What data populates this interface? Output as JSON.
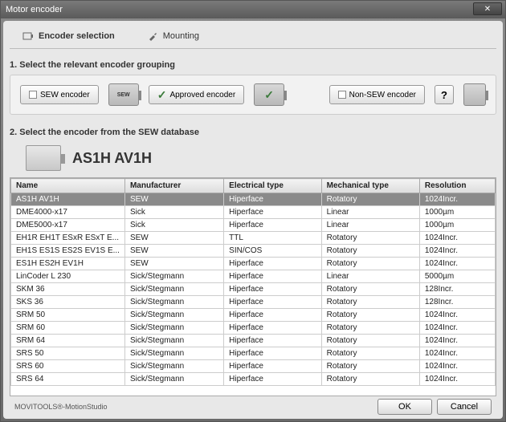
{
  "window": {
    "title": "Motor encoder"
  },
  "tabs": {
    "encoder_selection": "Encoder selection",
    "mounting": "Mounting"
  },
  "section1": {
    "heading": "1. Select the relevant encoder grouping",
    "sew_btn": "SEW encoder",
    "sew_chip": "SEW",
    "approved_btn": "Approved encoder",
    "non_sew_btn": "Non-SEW encoder",
    "help": "?"
  },
  "section2": {
    "heading": "2. Select the encoder from the SEW database",
    "selected_name": "AS1H AV1H"
  },
  "table": {
    "columns": [
      "Name",
      "Manufacturer",
      "Electrical type",
      "Mechanical type",
      "Resolution"
    ],
    "rows": [
      {
        "name": "AS1H AV1H",
        "manufacturer": "SEW",
        "electrical": "Hiperface",
        "mechanical": "Rotatory",
        "resolution": "1024Incr.",
        "selected": true
      },
      {
        "name": "DME4000-x17",
        "manufacturer": "Sick",
        "electrical": "Hiperface",
        "mechanical": "Linear",
        "resolution": "1000µm"
      },
      {
        "name": "DME5000-x17",
        "manufacturer": "Sick",
        "electrical": "Hiperface",
        "mechanical": "Linear",
        "resolution": "1000µm"
      },
      {
        "name": "EH1R EH1T ESxR ESxT E...",
        "manufacturer": "SEW",
        "electrical": "TTL",
        "mechanical": "Rotatory",
        "resolution": "1024Incr."
      },
      {
        "name": "EH1S ES1S ES2S EV1S E...",
        "manufacturer": "SEW",
        "electrical": "SIN/COS",
        "mechanical": "Rotatory",
        "resolution": "1024Incr."
      },
      {
        "name": "ES1H ES2H EV1H",
        "manufacturer": "SEW",
        "electrical": "Hiperface",
        "mechanical": "Rotatory",
        "resolution": "1024Incr."
      },
      {
        "name": "LinCoder L 230",
        "manufacturer": "Sick/Stegmann",
        "electrical": "Hiperface",
        "mechanical": "Linear",
        "resolution": "5000µm"
      },
      {
        "name": "SKM 36",
        "manufacturer": "Sick/Stegmann",
        "electrical": "Hiperface",
        "mechanical": "Rotatory",
        "resolution": "128Incr."
      },
      {
        "name": "SKS 36",
        "manufacturer": "Sick/Stegmann",
        "electrical": "Hiperface",
        "mechanical": "Rotatory",
        "resolution": "128Incr."
      },
      {
        "name": "SRM 50",
        "manufacturer": "Sick/Stegmann",
        "electrical": "Hiperface",
        "mechanical": "Rotatory",
        "resolution": "1024Incr."
      },
      {
        "name": "SRM 60",
        "manufacturer": "Sick/Stegmann",
        "electrical": "Hiperface",
        "mechanical": "Rotatory",
        "resolution": "1024Incr."
      },
      {
        "name": "SRM 64",
        "manufacturer": "Sick/Stegmann",
        "electrical": "Hiperface",
        "mechanical": "Rotatory",
        "resolution": "1024Incr."
      },
      {
        "name": "SRS 50",
        "manufacturer": "Sick/Stegmann",
        "electrical": "Hiperface",
        "mechanical": "Rotatory",
        "resolution": "1024Incr."
      },
      {
        "name": "SRS 60",
        "manufacturer": "Sick/Stegmann",
        "electrical": "Hiperface",
        "mechanical": "Rotatory",
        "resolution": "1024Incr."
      },
      {
        "name": "SRS 64",
        "manufacturer": "Sick/Stegmann",
        "electrical": "Hiperface",
        "mechanical": "Rotatory",
        "resolution": "1024Incr."
      }
    ]
  },
  "footer": {
    "status": "MOVITOOLS®-MotionStudio",
    "ok": "OK",
    "cancel": "Cancel"
  }
}
